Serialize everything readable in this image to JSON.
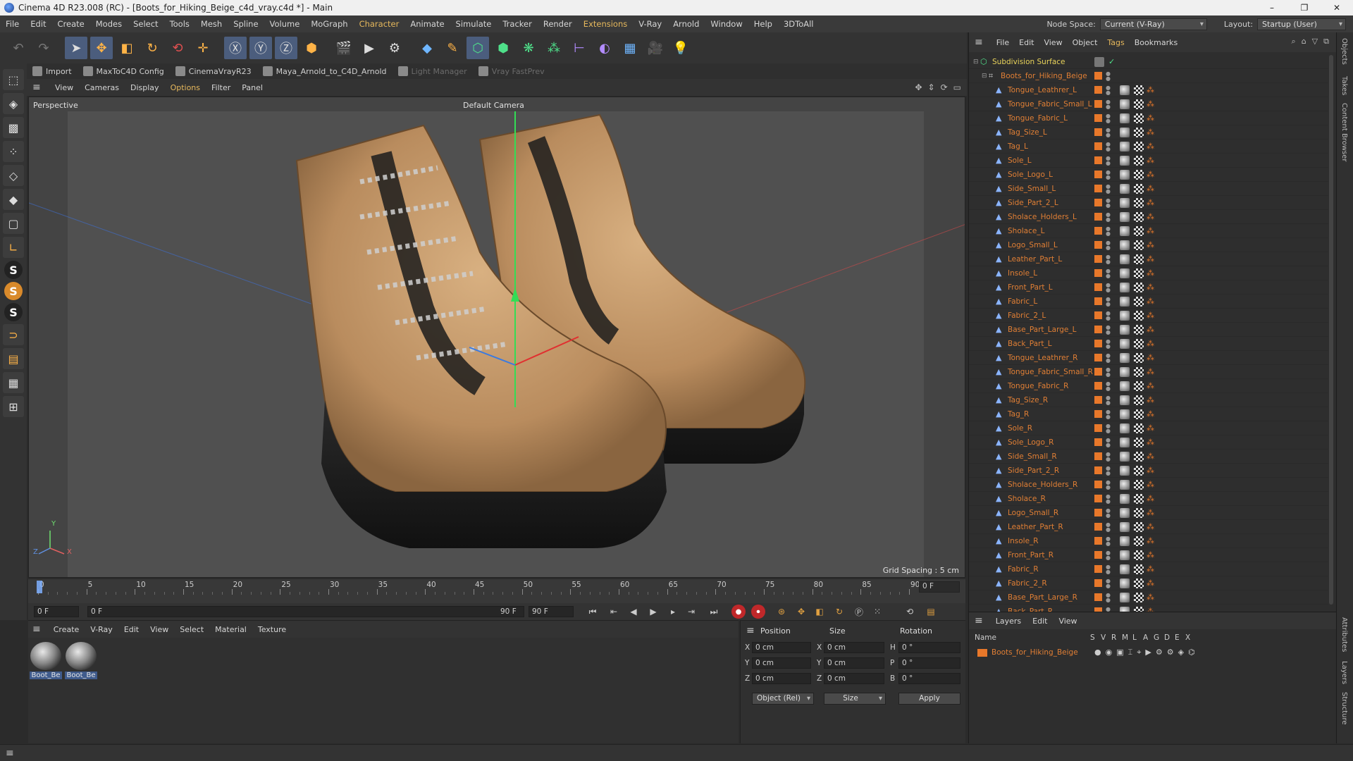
{
  "window": {
    "title": "Cinema 4D R23.008 (RC) - [Boots_for_Hiking_Beige_c4d_vray.c4d *] - Main",
    "controls": [
      "–",
      "❐",
      "✕"
    ]
  },
  "menubar": {
    "items": [
      "File",
      "Edit",
      "Create",
      "Modes",
      "Select",
      "Tools",
      "Mesh",
      "Spline",
      "Volume",
      "MoGraph",
      "Character",
      "Animate",
      "Simulate",
      "Tracker",
      "Render",
      "Extensions",
      "V-Ray",
      "Arnold",
      "Window",
      "Help",
      "3DToAll"
    ],
    "node_space_label": "Node Space:",
    "node_space_value": "Current (V-Ray)",
    "layout_label": "Layout:",
    "layout_value": "Startup (User)"
  },
  "plugin_bar": {
    "items": [
      {
        "label": "Import",
        "dim": false
      },
      {
        "label": "MaxToC4D Config",
        "dim": false
      },
      {
        "label": "CinemaVrayR23",
        "dim": false
      },
      {
        "label": "Maya_Arnold_to_C4D_Arnold",
        "dim": false
      },
      {
        "label": "Light Manager",
        "dim": true
      },
      {
        "label": "Vray FastPrev",
        "dim": true
      }
    ]
  },
  "viewport": {
    "menu": [
      "View",
      "Cameras",
      "Display",
      "Options",
      "Filter",
      "Panel"
    ],
    "projection_label": "Perspective",
    "camera_label": "Default Camera",
    "grid_spacing": "Grid Spacing : 5 cm",
    "axis_labels": {
      "x": "X",
      "y": "Y",
      "z": "Z"
    }
  },
  "timeline": {
    "ticks": [
      "0",
      "5",
      "10",
      "15",
      "20",
      "25",
      "30",
      "35",
      "40",
      "45",
      "50",
      "55",
      "60",
      "65",
      "70",
      "75",
      "80",
      "85",
      "90"
    ],
    "current_frame": "0 F",
    "start_field": "0 F",
    "range_start": "0 F",
    "range_end": "90 F",
    "end_field": "90 F"
  },
  "material_manager": {
    "menu": [
      "Create",
      "V-Ray",
      "Edit",
      "View",
      "Select",
      "Material",
      "Texture"
    ],
    "materials": [
      "Boot_Be",
      "Boot_Be"
    ]
  },
  "coordinates": {
    "headers": {
      "position": "Position",
      "size": "Size",
      "rotation": "Rotation"
    },
    "rows": [
      {
        "axis": "X",
        "pos": "0 cm",
        "size_axis": "X",
        "size": "0 cm",
        "rot_axis": "H",
        "rot": "0 °"
      },
      {
        "axis": "Y",
        "pos": "0 cm",
        "size_axis": "Y",
        "size": "0 cm",
        "rot_axis": "P",
        "rot": "0 °"
      },
      {
        "axis": "Z",
        "pos": "0 cm",
        "size_axis": "Z",
        "size": "0 cm",
        "rot_axis": "B",
        "rot": "0 °"
      }
    ],
    "mode_dropdown": "Object (Rel)",
    "size_dropdown": "Size",
    "apply_label": "Apply"
  },
  "object_manager": {
    "menu": [
      "File",
      "Edit",
      "View",
      "Object",
      "Tags",
      "Bookmarks"
    ],
    "root": "Subdivision Surface",
    "group": "Boots_for_Hiking_Beige",
    "objects": [
      "Tongue_Leathrer_L",
      "Tongue_Fabric_Small_L",
      "Tongue_Fabric_L",
      "Tag_Size_L",
      "Tag_L",
      "Sole_L",
      "Sole_Logo_L",
      "Side_Small_L",
      "Side_Part_2_L",
      "Sholace_Holders_L",
      "Sholace_L",
      "Logo_Small_L",
      "Leather_Part_L",
      "Insole_L",
      "Front_Part_L",
      "Fabric_L",
      "Fabric_2_L",
      "Base_Part_Large_L",
      "Back_Part_L",
      "Tongue_Leathrer_R",
      "Tongue_Fabric_Small_R",
      "Tongue_Fabric_R",
      "Tag_Size_R",
      "Tag_R",
      "Sole_R",
      "Sole_Logo_R",
      "Side_Small_R",
      "Side_Part_2_R",
      "Sholace_Holders_R",
      "Sholace_R",
      "Logo_Small_R",
      "Leather_Part_R",
      "Insole_R",
      "Front_Part_R",
      "Fabric_R",
      "Fabric_2_R",
      "Base_Part_Large_R",
      "Back_Part_R"
    ]
  },
  "layers": {
    "menu": [
      "Layers",
      "Edit",
      "View"
    ],
    "columns": [
      "Name",
      "S",
      "V",
      "R",
      "M",
      "L",
      "A",
      "G",
      "D",
      "E",
      "X"
    ],
    "layer_name": "Boots_for_Hiking_Beige"
  },
  "side_tabs": [
    "Objects",
    "Takes",
    "Content Browser",
    "Attributes",
    "Layers",
    "Structure"
  ],
  "colors": {
    "accent_orange": "#e8782a",
    "object_name_orange": "#e07f35",
    "root_name_yellow": "#e8d25a",
    "menu_highlight": "#e6b85c"
  }
}
